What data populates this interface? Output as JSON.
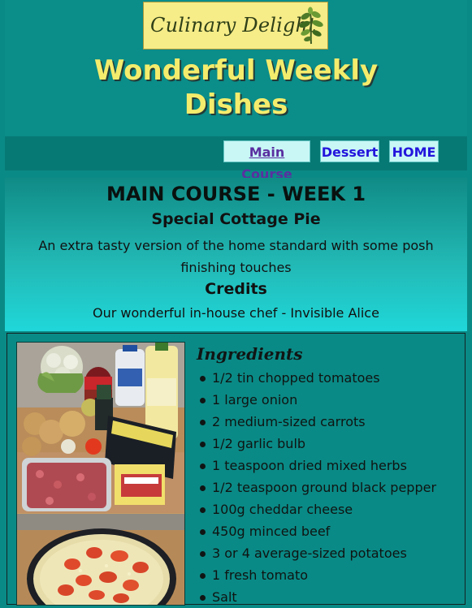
{
  "header": {
    "logo_text": "Culinary Delight",
    "logo_icon": "herb-sprig-icon",
    "title_line1": "Wonderful Weekly",
    "title_line2": "Dishes",
    "accent_color": "#f4ec6c",
    "logo_bg_color": "#f6ec88"
  },
  "nav": {
    "items": [
      {
        "label": "Main Course"
      },
      {
        "label": "Dessert"
      },
      {
        "label": "HOME"
      }
    ]
  },
  "intro": {
    "course_heading": "MAIN COURSE - WEEK 1",
    "dish_title": "Special Cottage Pie",
    "description": "An extra tasty version of the home standard with some posh finishing touches",
    "credits_title": "Credits",
    "credits_text": "Our wonderful in-house chef - Invisible Alice"
  },
  "ingredients": {
    "heading": "Ingredients",
    "items": [
      "1/2 tin chopped tomatoes",
      "1 large onion",
      "2 medium-sized carrots",
      "1/2 garlic bulb",
      "1 teaspoon dried mixed herbs",
      "1/2 teaspoon ground black pepper",
      "100g cheddar cheese",
      "450g minced beef",
      "3 or 4 average-sized potatoes",
      "1 fresh tomato",
      "Salt"
    ]
  },
  "theme": {
    "page_bg": "#0a8a86",
    "link_color": "#2315dc",
    "visited_link_color": "#5a2fa0"
  }
}
